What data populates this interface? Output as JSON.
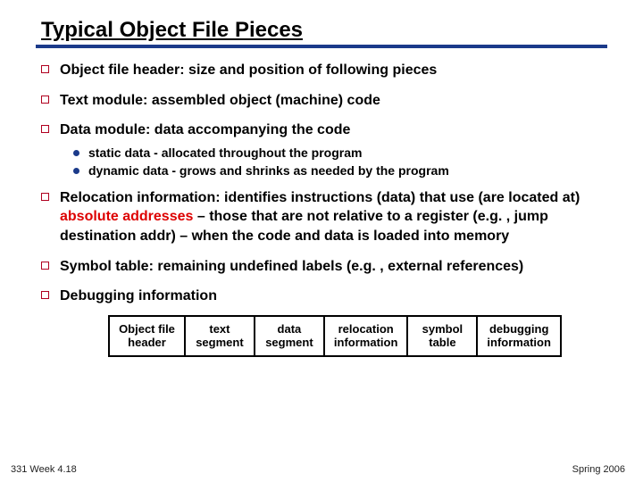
{
  "title": "Typical Object File Pieces",
  "bullets": {
    "b1": "Object file header: size and position of following pieces",
    "b2": "Text module:  assembled object (machine) code",
    "b3": "Data module:  data accompanying the code",
    "b3_sub": {
      "s1": "static data - allocated throughout the program",
      "s2": "dynamic data - grows and shrinks as needed by the program"
    },
    "b4_pre": "Relocation information:  identifies instructions (data) that use (are located at) ",
    "b4_red": "absolute addresses",
    "b4_post": " – those that are not relative to a register (e.g. , jump destination addr) – when the code and data is loaded into memory",
    "b5": "Symbol table:  remaining undefined labels (e.g. , external references)",
    "b6": "Debugging information"
  },
  "boxes": {
    "c1a": "Object file",
    "c1b": "header",
    "c2a": "text",
    "c2b": "segment",
    "c3a": "data",
    "c3b": "segment",
    "c4a": "relocation",
    "c4b": "information",
    "c5a": "symbol",
    "c5b": "table",
    "c6a": "debugging",
    "c6b": "information"
  },
  "footer": {
    "left": "331 Week 4.18",
    "right": "Spring 2006"
  }
}
